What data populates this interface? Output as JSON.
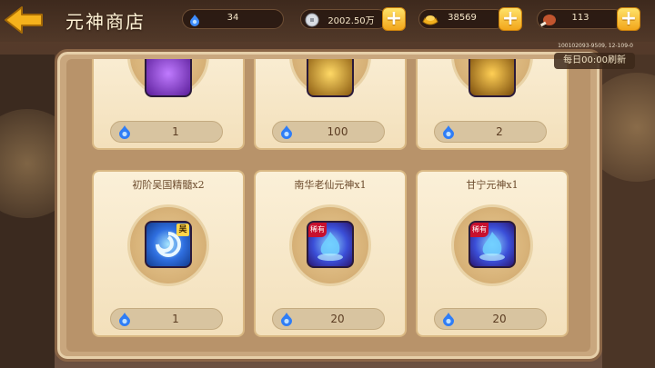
{
  "header": {
    "title": "元神商店",
    "resources": [
      {
        "name": "spirit",
        "icon": "blue-flame-icon",
        "value": "34"
      },
      {
        "name": "silver",
        "icon": "silver-coin-icon",
        "value": "2002.50万"
      },
      {
        "name": "gold",
        "icon": "gold-ingot-icon",
        "value": "38569"
      },
      {
        "name": "stamina",
        "icon": "meat-icon",
        "value": "113"
      }
    ]
  },
  "panel": {
    "refresh_label": "每日00:00刷新",
    "server_id": "100102093-9509, 12-109-0"
  },
  "shop_items": [
    {
      "name": "",
      "price": "1",
      "icon": "purple-orb-icon",
      "rare": false
    },
    {
      "name": "",
      "price": "100",
      "icon": "gold-orb-icon",
      "rare": false
    },
    {
      "name": "",
      "price": "2",
      "icon": "gold-orb-icon",
      "rare": false
    },
    {
      "name": "初阶吴国精髓x2",
      "price": "1",
      "icon": "wu-essence-icon",
      "rare": false,
      "badge": "吴"
    },
    {
      "name": "南华老仙元神x1",
      "price": "20",
      "icon": "blue-spirit-icon",
      "rare": true,
      "rare_label": "稀有"
    },
    {
      "name": "甘宁元神x1",
      "price": "20",
      "icon": "blue-spirit-icon",
      "rare": true,
      "rare_label": "稀有"
    }
  ],
  "colors": {
    "accent_gold": "#f2a51a",
    "flame_blue": "#2f7df6",
    "panel_bg": "#c9a77e",
    "rare_red": "#c8102e"
  }
}
